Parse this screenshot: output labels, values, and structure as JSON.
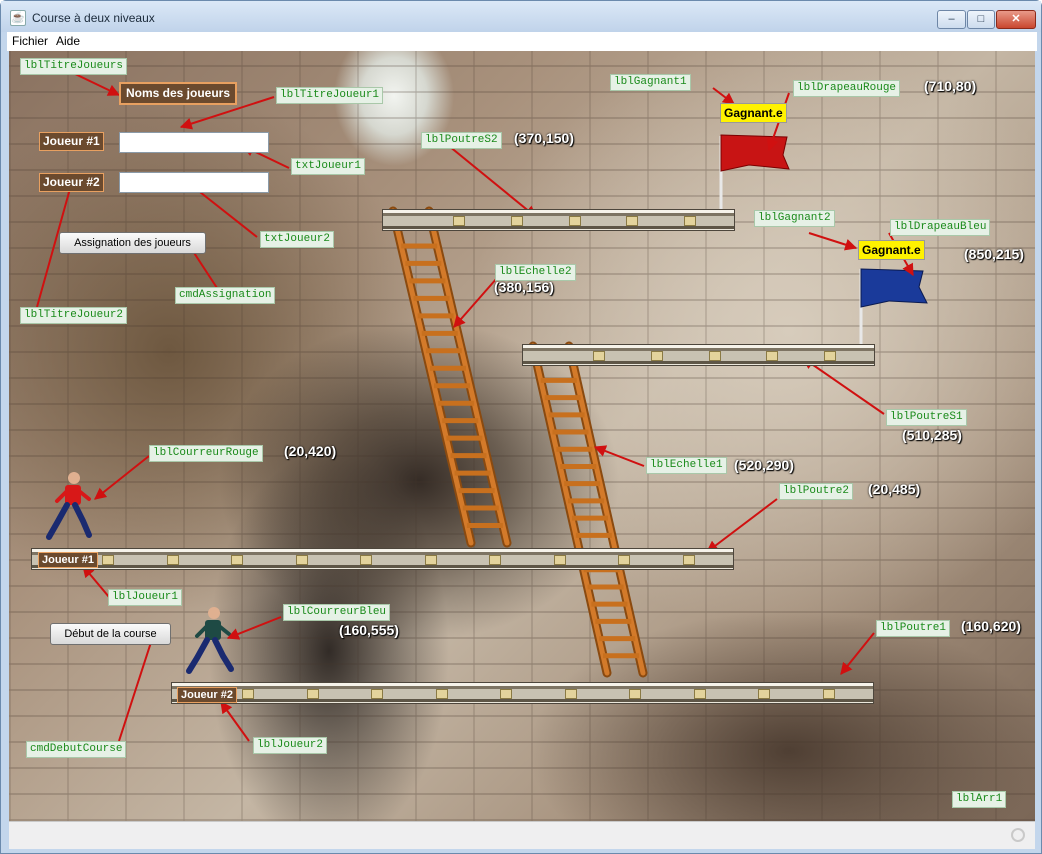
{
  "window": {
    "title": "Course à deux niveaux",
    "minimize": "–",
    "maximize": "□",
    "close": "✕",
    "icon": "java-cup-icon"
  },
  "menu": {
    "items": [
      "Fichier",
      "Aide"
    ]
  },
  "form": {
    "title_players": "Noms des joueurs",
    "player1_label": "Joueur #1",
    "player2_label": "Joueur #2",
    "player1_value": "",
    "player2_value": "",
    "assign_button": "Assignation des joueurs",
    "start_button": "Début de la course"
  },
  "game": {
    "runner1_tag": "Joueur #1",
    "runner2_tag": "Joueur #2",
    "winner_text": "Gagnant.e",
    "flag_red_color": "#c81414",
    "flag_blue_color": "#1a3a9a"
  },
  "annotations": {
    "lblTitreJoueurs": "lblTitreJoueurs",
    "lblTitreJoueur1": "lblTitreJoueur1",
    "txtJoueur1": "txtJoueur1",
    "txtJoueur2": "txtJoueur2",
    "cmdAssignation": "cmdAssignation",
    "lblTitreJoueur2": "lblTitreJoueur2",
    "lblPoutreS2": "lblPoutreS2",
    "lblPoutreS2_coord": "(370,150)",
    "lblGagnant1": "lblGagnant1",
    "lblDrapeauRouge": "lblDrapeauRouge",
    "lblDrapeauRouge_coord": "(710,80)",
    "lblGagnant2": "lblGagnant2",
    "lblDrapeauBleu": "lblDrapeauBleu",
    "lblDrapeauBleu_coord": "(850,215)",
    "lblEchelle2": "lblEchelle2",
    "lblEchelle2_coord": "(380,156)",
    "lblPoutreS1": "lblPoutreS1",
    "lblPoutreS1_coord": "(510,285)",
    "lblCourreurRouge": "lblCourreurRouge",
    "lblCourreurRouge_coord": "(20,420)",
    "lblEchelle1": "lblEchelle1",
    "lblEchelle1_coord": "(520,290)",
    "lblPoutre2": "lblPoutre2",
    "lblPoutre2_coord": "(20,485)",
    "lblJoueur1": "lblJoueur1",
    "lblCourreurBleu": "lblCourreurBleu",
    "lblCourreurBleu_coord": "(160,555)",
    "lblPoutre1": "lblPoutre1",
    "lblPoutre1_coord": "(160,620)",
    "cmdDebutCourse": "cmdDebutCourse",
    "lblJoueur2": "lblJoueur2",
    "lblArr1": "lblArr1"
  }
}
